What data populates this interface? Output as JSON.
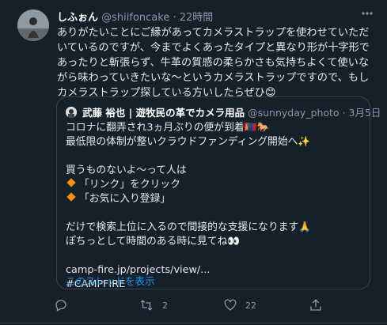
{
  "tweet": {
    "display_name": "しふぉん",
    "handle": "@shiifoncake",
    "dot": "·",
    "time": "22時間",
    "more_icon": "more-icon",
    "text": "ありがたいことにご縁があってカメラストラップを使わせていただいているのですが、今までよくあったタイプと異なり形が十字形であったりと斬張らず、牛革の質感の柔らかさも気持ちよくて使いながら味わっていきたいな～というカメラストラップですので、もしカメラストラップ探している方いしたらぜひ😊",
    "quote": {
      "display_name": "武藤 裕也 | 遊牧民の革でカメラ用品",
      "handle": "@sunnyday_photo",
      "dot": "·",
      "date": "3月5日",
      "lines": [
        "コロナに翻弄され3ヵ月ぶりの便が到着🇲🇳🐎",
        "最低限の体制が整いクラウドファンディング開始へ✨",
        "",
        "買うものないよ～って人は",
        "「リンク」をクリック",
        "「お気に入り登録」",
        "",
        "だけで検索上位に入るので間接的な支援になります🙏",
        "ぽちっとして時間のある時に見てね👀",
        "",
        "camp-fire.jp/projects/view/...",
        "#CAMPFIRE"
      ],
      "show_thread": "このスレッドを表示"
    },
    "actions": {
      "reply_count": "",
      "retweet_count": "2",
      "like_count": "22",
      "share_count": ""
    }
  }
}
